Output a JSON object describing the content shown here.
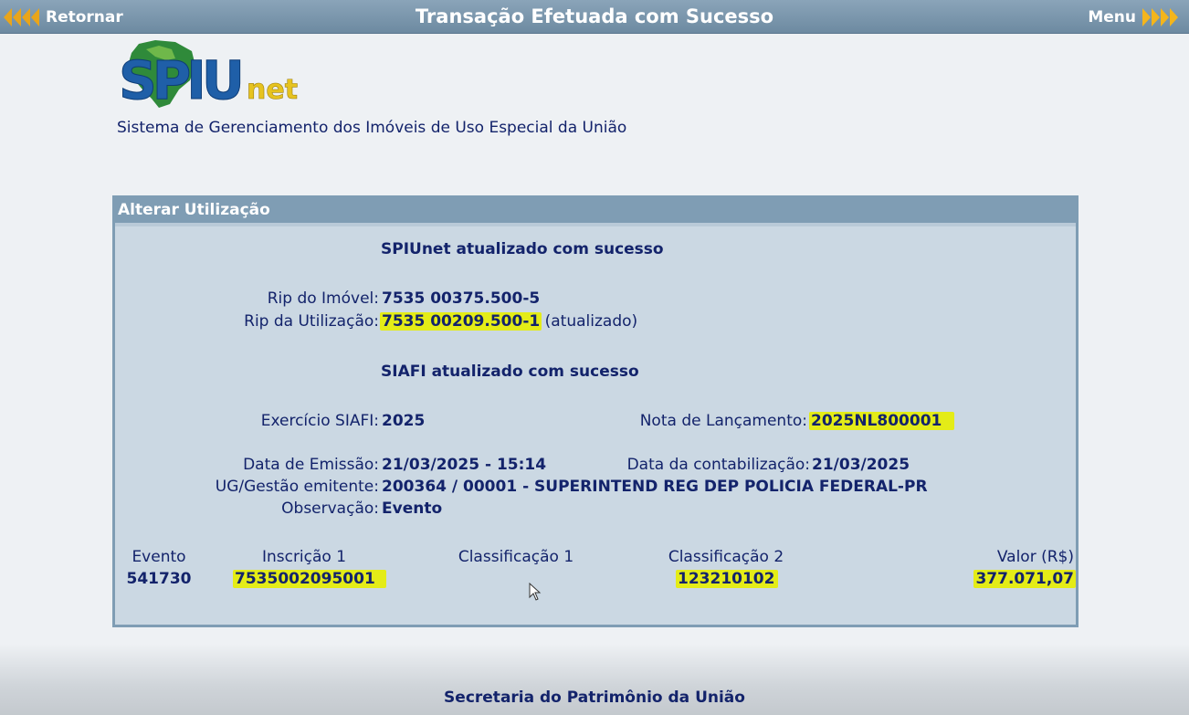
{
  "topbar": {
    "back_label": "Retornar",
    "title": "Transação Efetuada com Sucesso",
    "menu_label": "Menu"
  },
  "header": {
    "logo_text": "SPIUnet",
    "subtitle": "Sistema de Gerenciamento dos Imóveis de Uso Especial da União"
  },
  "panel": {
    "title": "Alterar Utilização",
    "spiunet_status": "SPIUnet atualizado com sucesso",
    "rip_imovel_label": "Rip do Imóvel:",
    "rip_imovel_value": "7535 00375.500-5",
    "rip_utilizacao_label": "Rip da Utilização:",
    "rip_utilizacao_value": "7535 00209.500-1",
    "rip_utilizacao_note": "(atualizado)",
    "siafi_status": "SIAFI atualizado com sucesso",
    "exercicio_label": "Exercício SIAFI:",
    "exercicio_value": "2025",
    "nota_label": "Nota de Lançamento:",
    "nota_value": "2025NL800001",
    "data_emissao_label": "Data de Emissão:",
    "data_emissao_value": "21/03/2025 - 15:14",
    "data_contab_label": "Data da contabilização:",
    "data_contab_value": "21/03/2025",
    "ug_label": "UG/Gestão emitente:",
    "ug_value": "200364 / 00001 - SUPERINTEND REG DEP POLICIA FEDERAL-PR",
    "observacao_label": "Observação:",
    "observacao_value": "Evento",
    "table": {
      "headers": [
        "Evento",
        "Inscrição 1",
        "Classificação 1",
        "Classificação 2",
        "Valor (R$)"
      ],
      "row": {
        "evento": "541730",
        "inscricao1": "7535002095001",
        "classificacao1": "",
        "classificacao2": "123210102",
        "valor": "377.071,07"
      }
    }
  },
  "footer": {
    "text": "Secretaria do Patrimônio da União"
  },
  "colors": {
    "highlight": "#e4ec17",
    "header_bar": "#7f9db4",
    "text": "#13236b",
    "arrow": "#f4b51c"
  }
}
